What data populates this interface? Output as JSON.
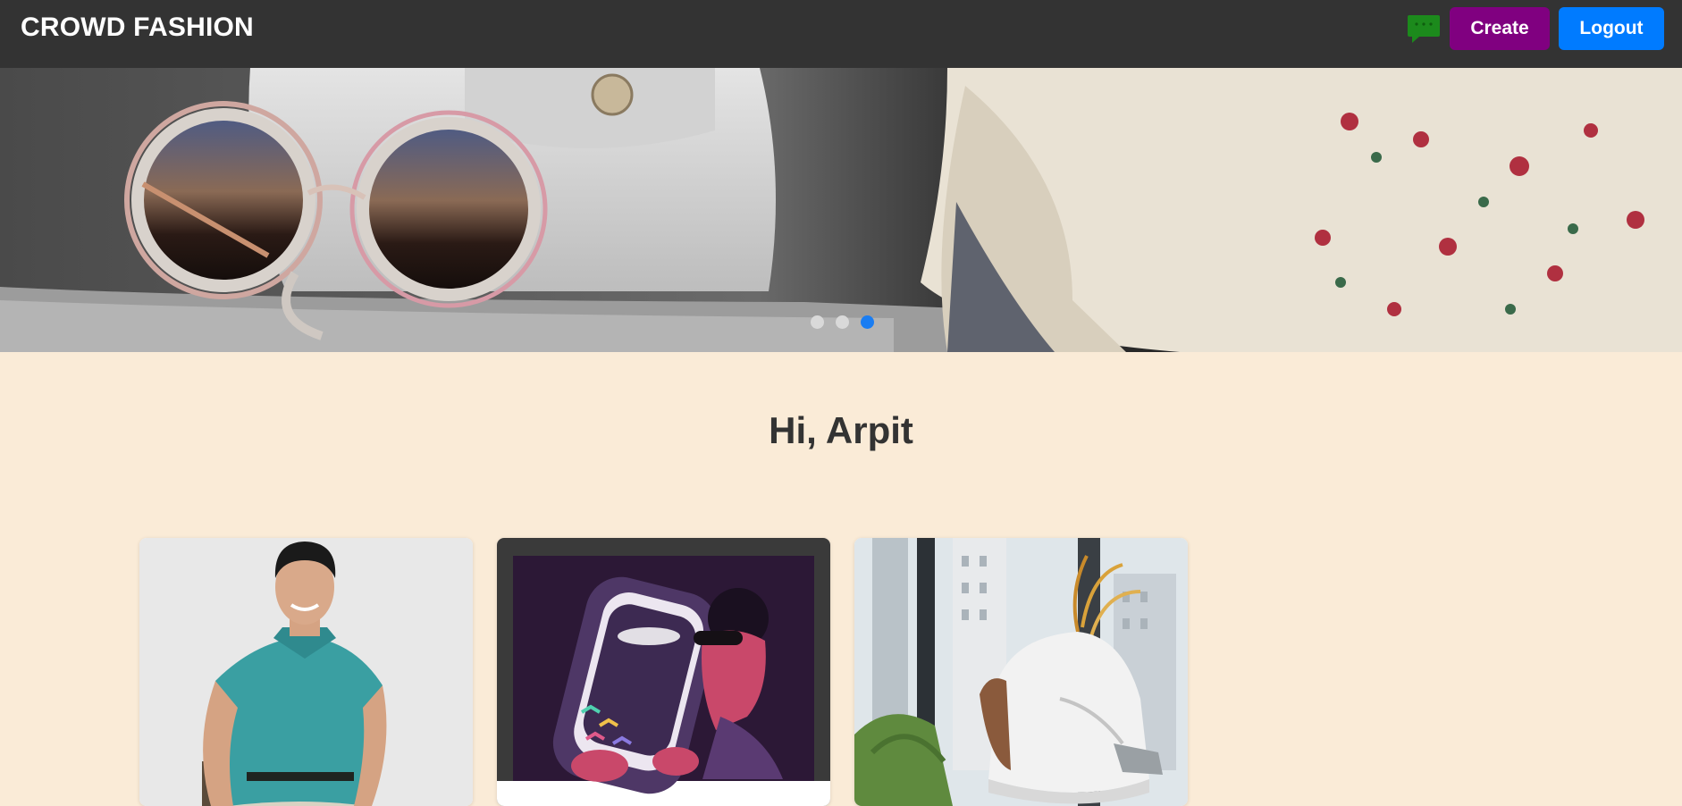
{
  "navbar": {
    "brand": "CROWD FASHION",
    "chat_icon": "chat-bubble-icon",
    "create_label": "Create",
    "logout_label": "Logout",
    "colors": {
      "navbar_bg": "#333333",
      "create_bg": "#800080",
      "logout_bg": "#007bff",
      "chat_icon": "#1c8a1c"
    }
  },
  "hero": {
    "slides": [
      {
        "image": "slide-1"
      },
      {
        "image": "slide-2"
      },
      {
        "image": "sunglasses-handbag-embroidered-blouse"
      }
    ],
    "active_slide": 2
  },
  "main": {
    "greeting": "Hi, Arpit",
    "background": "#faebd7",
    "cards": [
      {
        "image": "man-in-teal-polo-shirt"
      },
      {
        "image": "illustration-man-with-sunglasses-gaming"
      },
      {
        "image": "white-high-top-sneakers"
      }
    ]
  }
}
